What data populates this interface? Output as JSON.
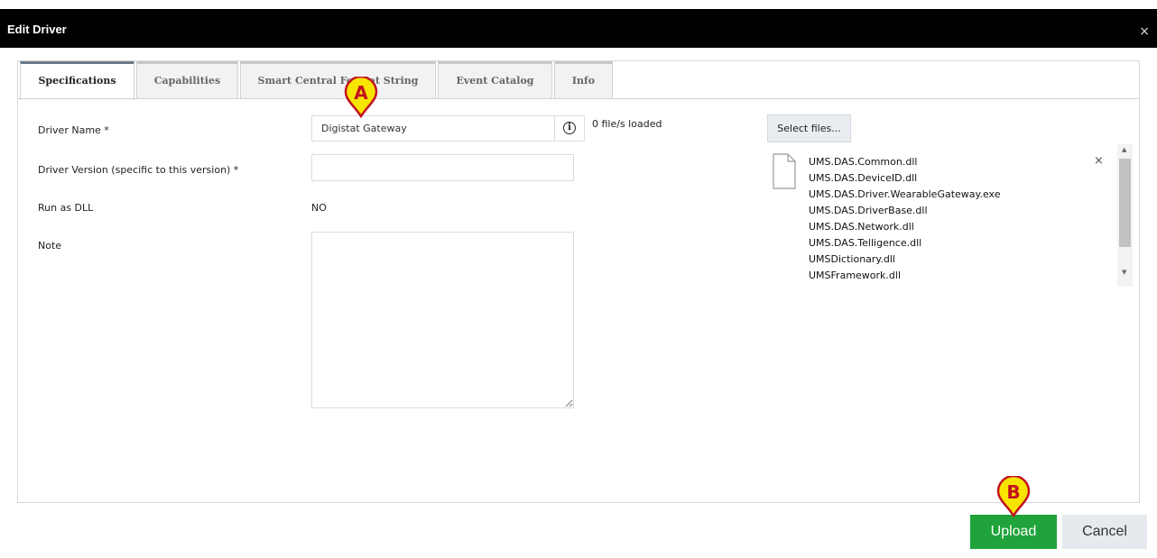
{
  "dialog": {
    "title": "Edit Driver",
    "close_label": "×"
  },
  "tabs": [
    {
      "label": "Specifications",
      "active": true
    },
    {
      "label": "Capabilities",
      "active": false
    },
    {
      "label": "Smart Central Format String",
      "active": false
    },
    {
      "label": "Event Catalog",
      "active": false
    },
    {
      "label": "Info",
      "active": false
    }
  ],
  "form": {
    "driver_name": {
      "label": "Driver Name *",
      "value": "Digistat Gateway"
    },
    "driver_version": {
      "label": "Driver Version (specific to this version) *",
      "value": ""
    },
    "run_as_dll": {
      "label": "Run as DLL",
      "value": "NO"
    },
    "note": {
      "label": "Note",
      "value": ""
    },
    "info_icon": "info-circle-icon",
    "files_loaded": "0 file/s loaded"
  },
  "files": {
    "select_label": "Select files...",
    "remove_label": "×",
    "items": [
      "UMS.DAS.Common.dll",
      "UMS.DAS.DeviceID.dll",
      "UMS.DAS.Driver.WearableGateway.exe",
      "UMS.DAS.DriverBase.dll",
      "UMS.DAS.Network.dll",
      "UMS.DAS.Telligence.dll",
      "UMSDictionary.dll",
      "UMSFramework.dll"
    ]
  },
  "footer": {
    "upload_label": "Upload",
    "cancel_label": "Cancel"
  },
  "markers": [
    {
      "letter": "A"
    },
    {
      "letter": "B"
    }
  ],
  "colors": {
    "upload": "#1fa33a",
    "marker_fill": "#f7e400",
    "marker_border": "#c2121f"
  }
}
